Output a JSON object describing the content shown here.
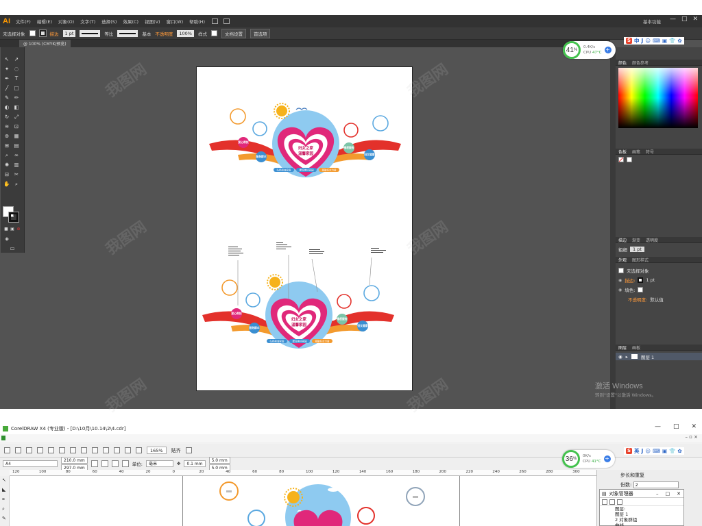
{
  "illustrator": {
    "logo": "Ai",
    "menu": [
      "文件(F)",
      "编辑(E)",
      "对象(O)",
      "文字(T)",
      "选择(S)",
      "效果(C)",
      "视图(V)",
      "窗口(W)",
      "帮助(H)"
    ],
    "workspace_label": "基本功能",
    "window_buttons": [
      "—",
      "□",
      "✕"
    ],
    "control": {
      "selection_state": "未选择对象",
      "stroke_label": "描边",
      "stroke_weight": "1 pt",
      "profile_label": "等比",
      "brush_label": "基本",
      "opacity_label": "不透明度",
      "opacity_value": "100%",
      "style_label": "样式",
      "doc_settings_button": "文档设置",
      "preferences_button": "首选项"
    },
    "doc_tab": "@ 100% (CMYK/预览)",
    "panels": {
      "color_tabs": [
        "颜色",
        "颜色参考"
      ],
      "swatches_tabs": [
        "色板",
        "画笔",
        "符号"
      ],
      "stroke_tabs": [
        "描边",
        "渐变",
        "透明度"
      ],
      "stroke_weight_label": "粗细",
      "stroke_weight_value": "1 pt",
      "appearance_tabs": [
        "外观",
        "图形样式"
      ],
      "appearance_title": "未选择对象",
      "appearance_stroke": "描边:",
      "appearance_stroke_value": "1 pt",
      "appearance_fill": "填色:",
      "appearance_opacity": "不透明度:",
      "appearance_opacity_value": "默认值",
      "layers_tabs": [
        "图层",
        "画板"
      ],
      "layer_name": "图层 1"
    },
    "activate": {
      "line1": "激活 Windows",
      "line2": "转到\"设置\"以激活 Windows。"
    },
    "cpu": {
      "percent": "41",
      "unit": "%",
      "speed": "0.4K/s",
      "label": "CPU",
      "temp": "47°C"
    },
    "ime": [
      "中",
      "J",
      "☺",
      "⌨",
      "▣",
      "👕",
      "✿"
    ]
  },
  "design": {
    "title_line1": "妇女之家",
    "title_line2": "温馨家园",
    "badges": [
      "爱心帮扶",
      "服务群众",
      "维权服务",
      "妇女健康"
    ],
    "banners": [
      "弘扬和谐家庭",
      "建设美好家园",
      "凝聚妇女力量"
    ],
    "colors": {
      "magenta": "#e0287a",
      "red": "#e3312b",
      "sky": "#8ecaf0",
      "orange": "#f39a2e",
      "teal": "#7cc4a8"
    }
  },
  "coreldraw": {
    "title": "CorelDRAW X4 (专业版) - [D:\\10月\\10.14\\2\\4.cdr]",
    "window_buttons": [
      "—",
      "□",
      "✕"
    ],
    "zoom": "165%",
    "snap_label": "贴齐",
    "page_size": "A4",
    "width": "210.0 mm",
    "height": "297.0 mm",
    "unit_label": "单位:",
    "unit_value": "毫米",
    "nudge": "0.1 mm",
    "dup_x": "5.0 mm",
    "dup_y": "5.0 mm",
    "ruler_ticks": [
      "120",
      "100",
      "80",
      "60",
      "40",
      "20",
      "0",
      "20",
      "40",
      "60",
      "80",
      "100",
      "120",
      "140",
      "160",
      "180",
      "200",
      "220",
      "240",
      "260",
      "280",
      "300"
    ],
    "cpu": {
      "percent": "36",
      "unit": "%",
      "speed": "0K/s",
      "label": "CPU",
      "temp": "41°C"
    },
    "ime": [
      "英",
      "J",
      "☺",
      "⌨",
      "▣",
      "👕",
      "✿"
    ],
    "docker_title": "步长和重复",
    "docker_count_label": "份数:",
    "docker_count_value": "2",
    "objmgr_title": "对象管理器",
    "objmgr_rows": [
      "图层:",
      "图层 1",
      "2 对象群组",
      "曲线"
    ]
  },
  "watermark": "我图网"
}
